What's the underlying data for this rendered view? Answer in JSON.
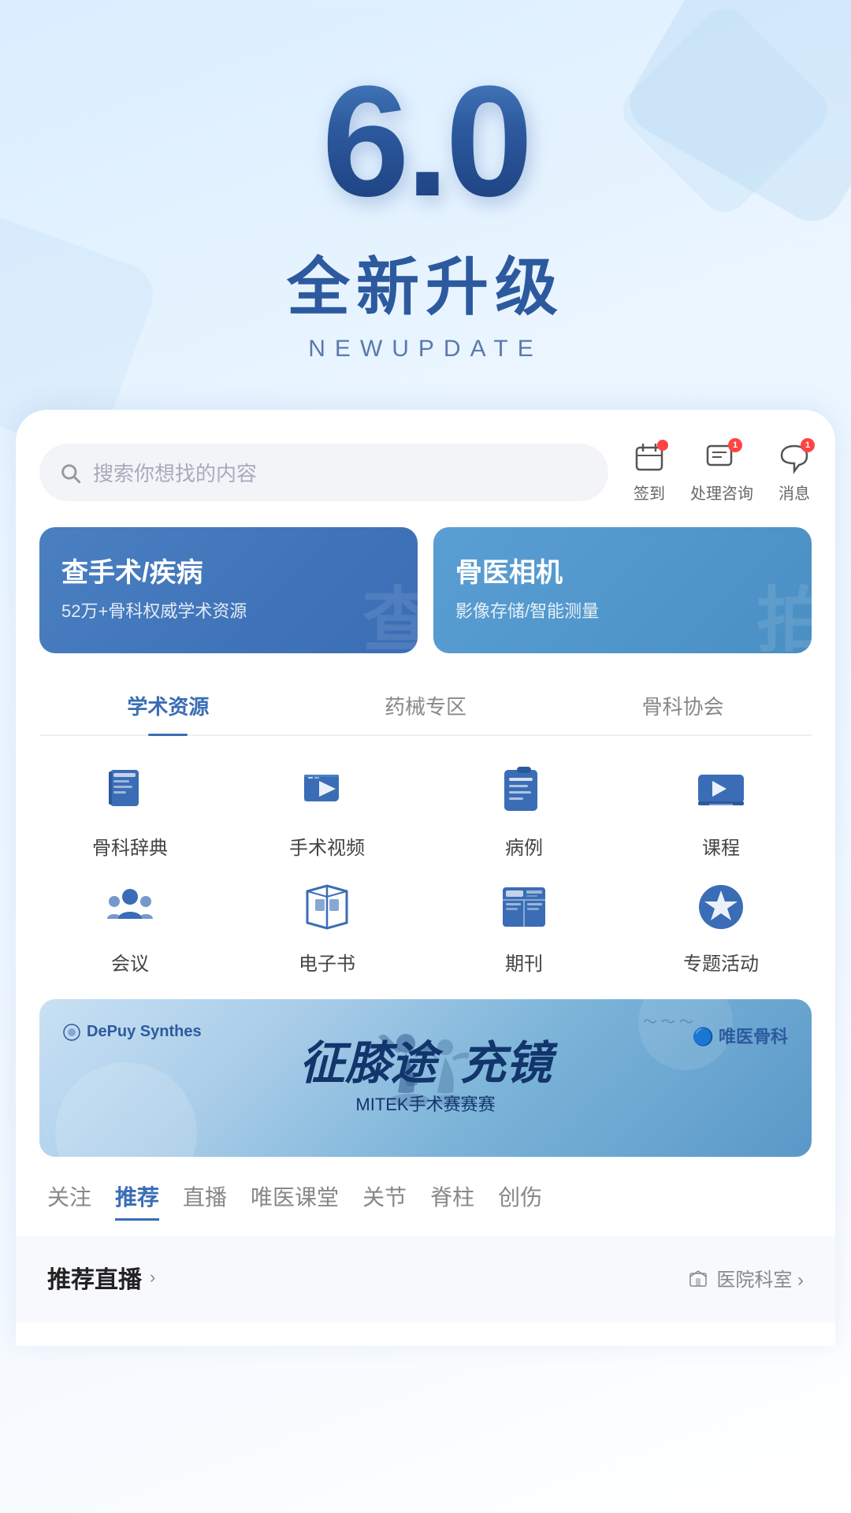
{
  "hero": {
    "version": "6.0",
    "title_cn": "全新升级",
    "title_en": "NEWUPDATE"
  },
  "search": {
    "placeholder": "搜索你想找的内容"
  },
  "header_actions": [
    {
      "id": "checkin",
      "label": "签到",
      "badge": null,
      "has_dot": true
    },
    {
      "id": "consult",
      "label": "处理咨询",
      "badge": "1",
      "has_badge": true
    },
    {
      "id": "message",
      "label": "消息",
      "badge": "1",
      "has_badge": true
    }
  ],
  "feature_banners": [
    {
      "id": "surgery",
      "title": "查手术/疾病",
      "subtitle": "52万+骨科权威学术资源",
      "bg_text": "查"
    },
    {
      "id": "camera",
      "title": "骨医相机",
      "subtitle": "影像存储/智能测量",
      "bg_text": "拍"
    }
  ],
  "tabs": [
    {
      "id": "academic",
      "label": "学术资源",
      "active": true
    },
    {
      "id": "pharma",
      "label": "药械专区",
      "active": false
    },
    {
      "id": "association",
      "label": "骨科协会",
      "active": false
    }
  ],
  "grid_icons": [
    {
      "id": "dictionary",
      "label": "骨科辞典",
      "icon": "book"
    },
    {
      "id": "surgery_video",
      "label": "手术视频",
      "icon": "video"
    },
    {
      "id": "case",
      "label": "病例",
      "icon": "document"
    },
    {
      "id": "course",
      "label": "课程",
      "icon": "course"
    },
    {
      "id": "meeting",
      "label": "会议",
      "icon": "meeting"
    },
    {
      "id": "ebook",
      "label": "电子书",
      "icon": "ebook"
    },
    {
      "id": "journal",
      "label": "期刊",
      "icon": "journal"
    },
    {
      "id": "special",
      "label": "专题活动",
      "icon": "special"
    }
  ],
  "ad_banner": {
    "brand_left": "DePuy Synthes",
    "brand_right": "唯医骨科",
    "main_text_left": "征膝途",
    "main_text_right": "充镜",
    "sub_text": "MITEK手术赛赛赛",
    "birds": "✦ ✦ ✦"
  },
  "content_tabs": [
    {
      "id": "follow",
      "label": "关注",
      "active": false
    },
    {
      "id": "recommend",
      "label": "推荐",
      "active": true
    },
    {
      "id": "live",
      "label": "直播",
      "active": false
    },
    {
      "id": "weiyiklass",
      "label": "唯医课堂",
      "active": false
    },
    {
      "id": "joint",
      "label": "关节",
      "active": false
    },
    {
      "id": "spine",
      "label": "脊柱",
      "active": false
    },
    {
      "id": "trauma",
      "label": "创伤",
      "active": false
    }
  ],
  "sections": [
    {
      "id": "live_section",
      "title": "推荐直播",
      "link": "医院科室 >"
    }
  ]
}
